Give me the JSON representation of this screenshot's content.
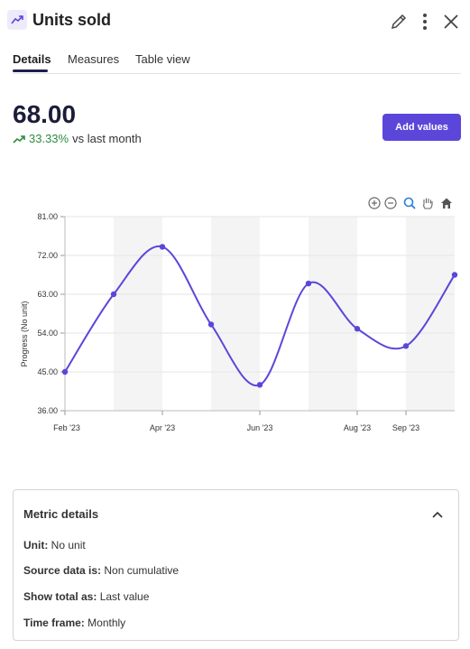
{
  "header": {
    "title": "Units sold",
    "icons": {
      "metric": "trend-up-icon",
      "edit": "pencil-icon",
      "more": "more-vertical-icon",
      "close": "close-icon"
    }
  },
  "tabs": [
    {
      "label": "Details",
      "active": true
    },
    {
      "label": "Measures",
      "active": false
    },
    {
      "label": "Table view",
      "active": false
    }
  ],
  "metric": {
    "value": "68.00",
    "change_pct": "33.33%",
    "change_text": "vs last month",
    "trend_color": "#2e8b3e"
  },
  "actions": {
    "add_values_label": "Add values"
  },
  "toolbar": {
    "icons": [
      "zoom-in-icon",
      "zoom-out-icon",
      "magnifier-icon",
      "pan-hand-icon",
      "home-icon"
    ]
  },
  "chart_data": {
    "type": "line",
    "ylabel": "Progress (No unit)",
    "ylim": [
      36,
      81
    ],
    "yticks": [
      "81.00",
      "72.00",
      "63.00",
      "54.00",
      "45.00",
      "36.00"
    ],
    "ytick_values": [
      81,
      72,
      63,
      54,
      45,
      36
    ],
    "x_tick_labels": [
      "Feb '23",
      "Apr '23",
      "Jun '23",
      "Aug '23",
      "Sep '23"
    ],
    "x": [
      "Feb '23",
      "Mar '23",
      "Apr '23",
      "May '23",
      "Jun '23",
      "Jul '23",
      "Aug '23",
      "Sep '23",
      "Oct '23"
    ],
    "values": [
      45,
      63,
      74,
      56,
      42,
      65.5,
      55,
      51,
      67.5
    ],
    "line_color": "#5a47d9",
    "grid": true
  },
  "details": {
    "title": "Metric details",
    "rows": [
      {
        "label": "Unit:",
        "value": "No unit"
      },
      {
        "label": "Source data is:",
        "value": "Non cumulative"
      },
      {
        "label": "Show total as:",
        "value": "Last value"
      },
      {
        "label": "Time frame:",
        "value": "Monthly"
      }
    ]
  }
}
